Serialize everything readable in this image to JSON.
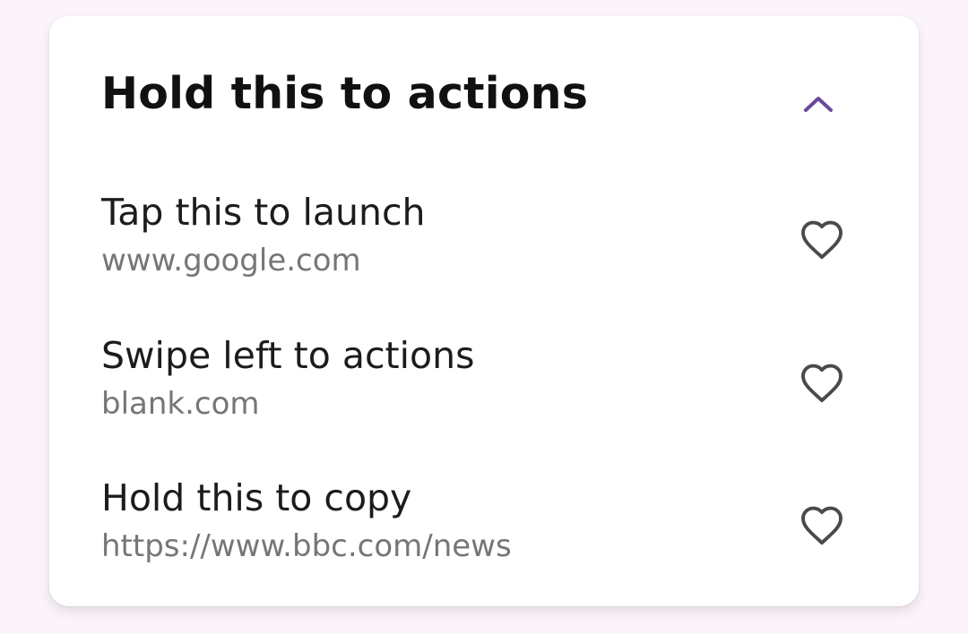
{
  "panel": {
    "title": "Hold this to actions",
    "collapse_icon": "chevron-up-icon",
    "accent_color": "#6a4a9c"
  },
  "items": [
    {
      "title": "Tap this to launch",
      "url": "www.google.com",
      "icon": "heart-outline-icon"
    },
    {
      "title": "Swipe left to actions",
      "url": "blank.com",
      "icon": "heart-outline-icon"
    },
    {
      "title": "Hold this to copy",
      "url": "https://www.bbc.com/news",
      "icon": "heart-outline-icon"
    }
  ]
}
